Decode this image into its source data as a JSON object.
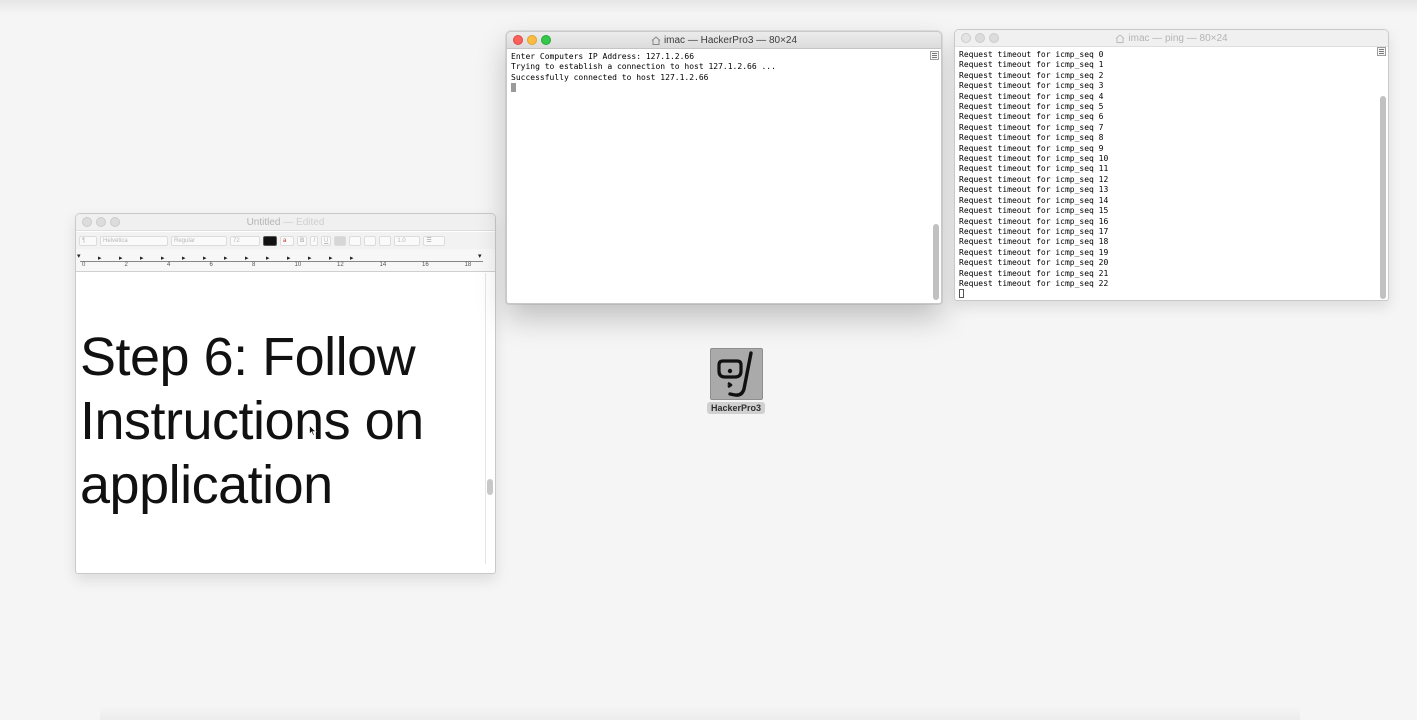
{
  "terminal_hackerpro": {
    "title": "imac — HackerPro3 — 80×24",
    "lines": [
      "Enter Computers IP Address: 127.1.2.66",
      "Trying to establish a connection to host 127.1.2.66 ...",
      "Successfully connected to host 127.1.2.66"
    ]
  },
  "terminal_ping": {
    "title": "imac — ping — 80×24",
    "lines": [
      "Request timeout for icmp_seq 0",
      "Request timeout for icmp_seq 1",
      "Request timeout for icmp_seq 2",
      "Request timeout for icmp_seq 3",
      "Request timeout for icmp_seq 4",
      "Request timeout for icmp_seq 5",
      "Request timeout for icmp_seq 6",
      "Request timeout for icmp_seq 7",
      "Request timeout for icmp_seq 8",
      "Request timeout for icmp_seq 9",
      "Request timeout for icmp_seq 10",
      "Request timeout for icmp_seq 11",
      "Request timeout for icmp_seq 12",
      "Request timeout for icmp_seq 13",
      "Request timeout for icmp_seq 14",
      "Request timeout for icmp_seq 15",
      "Request timeout for icmp_seq 16",
      "Request timeout for icmp_seq 17",
      "Request timeout for icmp_seq 18",
      "Request timeout for icmp_seq 19",
      "Request timeout for icmp_seq 20",
      "Request timeout for icmp_seq 21",
      "Request timeout for icmp_seq 22"
    ]
  },
  "textedit": {
    "title": "Untitled",
    "title_sep": "—",
    "title_status": "Edited",
    "toolbar": {
      "paragraph": "¶",
      "font_family": "Helvetica",
      "font_style": "Regular",
      "font_size": "72",
      "bold": "B",
      "italic": "I",
      "underline": "U",
      "line_spacing": "1.0"
    },
    "ruler_numbers": [
      "0",
      "2",
      "4",
      "6",
      "8",
      "10",
      "12",
      "14",
      "16",
      "18"
    ],
    "document_lines": [
      "Step 6: Follow",
      "Instructions on",
      "application"
    ]
  },
  "desktop": {
    "app_icon_label": "HackerPro3"
  },
  "colors": {
    "close": "#fc605c",
    "minimize": "#fdbc40",
    "zoom": "#34c84a",
    "app_tile": "#aaaaaa"
  }
}
